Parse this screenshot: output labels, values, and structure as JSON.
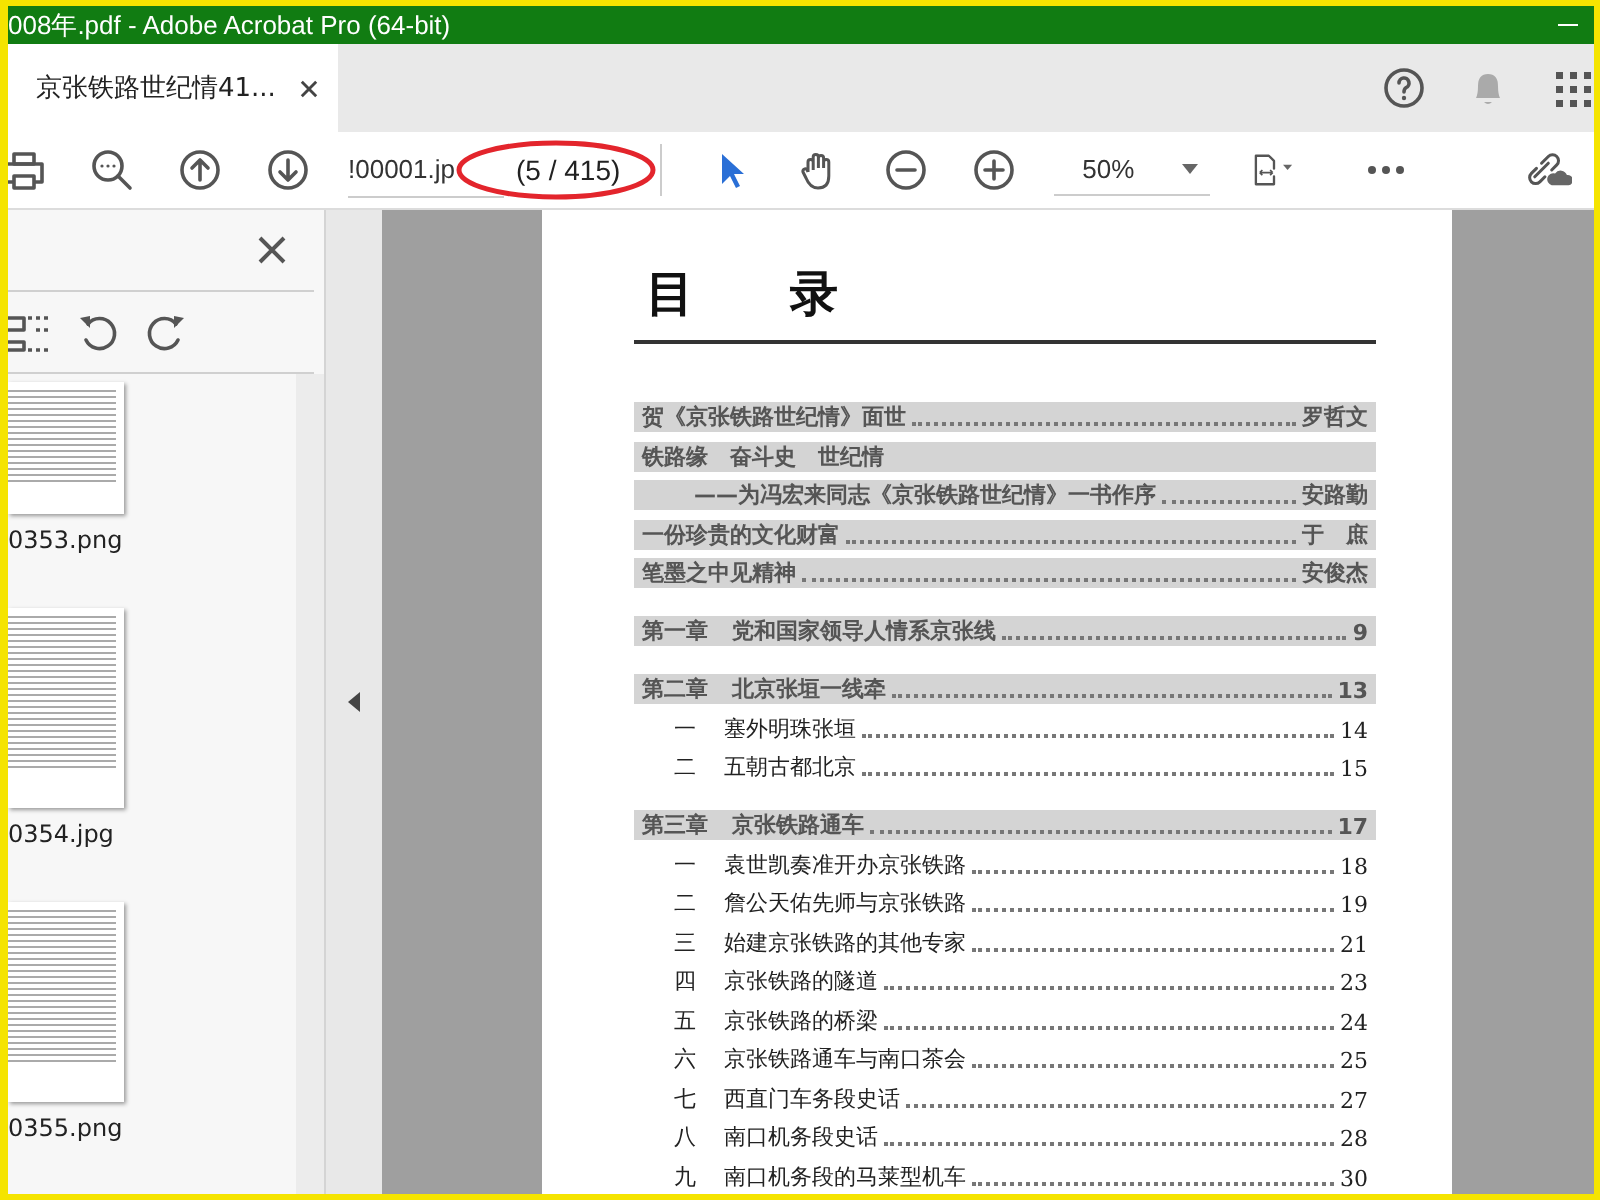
{
  "window": {
    "title": "008年.pdf - Adobe Acrobat Pro (64-bit)"
  },
  "tabs": [
    {
      "label": "京张铁路世纪情41...",
      "selected": true
    }
  ],
  "toolbar": {
    "page_field": {
      "value": "!00001.jp"
    },
    "page_count": "(5 / 415)",
    "zoom": {
      "value": "50%"
    },
    "tools": [
      {
        "kind": "select",
        "selected": true
      },
      {
        "kind": "hand",
        "selected": false
      }
    ]
  },
  "sidebar": {
    "thumbnails": [
      {
        "label": "0353.png"
      },
      {
        "label": "0354.jpg"
      },
      {
        "label": "0355.png"
      }
    ]
  },
  "document": {
    "heading": "目　　录",
    "entries": [
      {
        "kind": "front",
        "title": "贺《京张铁路世纪情》面世",
        "author": "罗哲文"
      },
      {
        "kind": "front",
        "title": "铁路缘　奋斗史　世纪情"
      },
      {
        "kind": "front-sub",
        "title": "——为冯宏来同志《京张铁路世纪情》一书作序",
        "author": "安路勤"
      },
      {
        "kind": "front",
        "title": "一份珍贵的文化财富",
        "author": "于　庶"
      },
      {
        "kind": "front",
        "title": "笔墨之中见精神",
        "author": "安俊杰"
      },
      {
        "kind": "chapter",
        "number": "第一章",
        "title": "党和国家领导人情系京张线",
        "page": "9"
      },
      {
        "kind": "chapter",
        "number": "第二章",
        "title": "北京张垣一线牵",
        "page": "13"
      },
      {
        "kind": "section",
        "number": "一",
        "title": "塞外明珠张垣",
        "page": "14"
      },
      {
        "kind": "section",
        "number": "二",
        "title": "五朝古都北京",
        "page": "15"
      },
      {
        "kind": "chapter",
        "number": "第三章",
        "title": "京张铁路通车",
        "page": "17"
      },
      {
        "kind": "section",
        "number": "一",
        "title": "袁世凯奏准开办京张铁路",
        "page": "18"
      },
      {
        "kind": "section",
        "number": "二",
        "title": "詹公天佑先师与京张铁路",
        "page": "19"
      },
      {
        "kind": "section",
        "number": "三",
        "title": "始建京张铁路的其他专家",
        "page": "21"
      },
      {
        "kind": "section",
        "number": "四",
        "title": "京张铁路的隧道",
        "page": "23"
      },
      {
        "kind": "section",
        "number": "五",
        "title": "京张铁路的桥梁",
        "page": "24"
      },
      {
        "kind": "section",
        "number": "六",
        "title": "京张铁路通车与南口茶会",
        "page": "25"
      },
      {
        "kind": "section",
        "number": "七",
        "title": "西直门车务段史话",
        "page": "27"
      },
      {
        "kind": "section",
        "number": "八",
        "title": "南口机务段史话",
        "page": "28"
      },
      {
        "kind": "section",
        "number": "九",
        "title": "南口机务段的马莱型机车",
        "page": "30"
      }
    ]
  }
}
